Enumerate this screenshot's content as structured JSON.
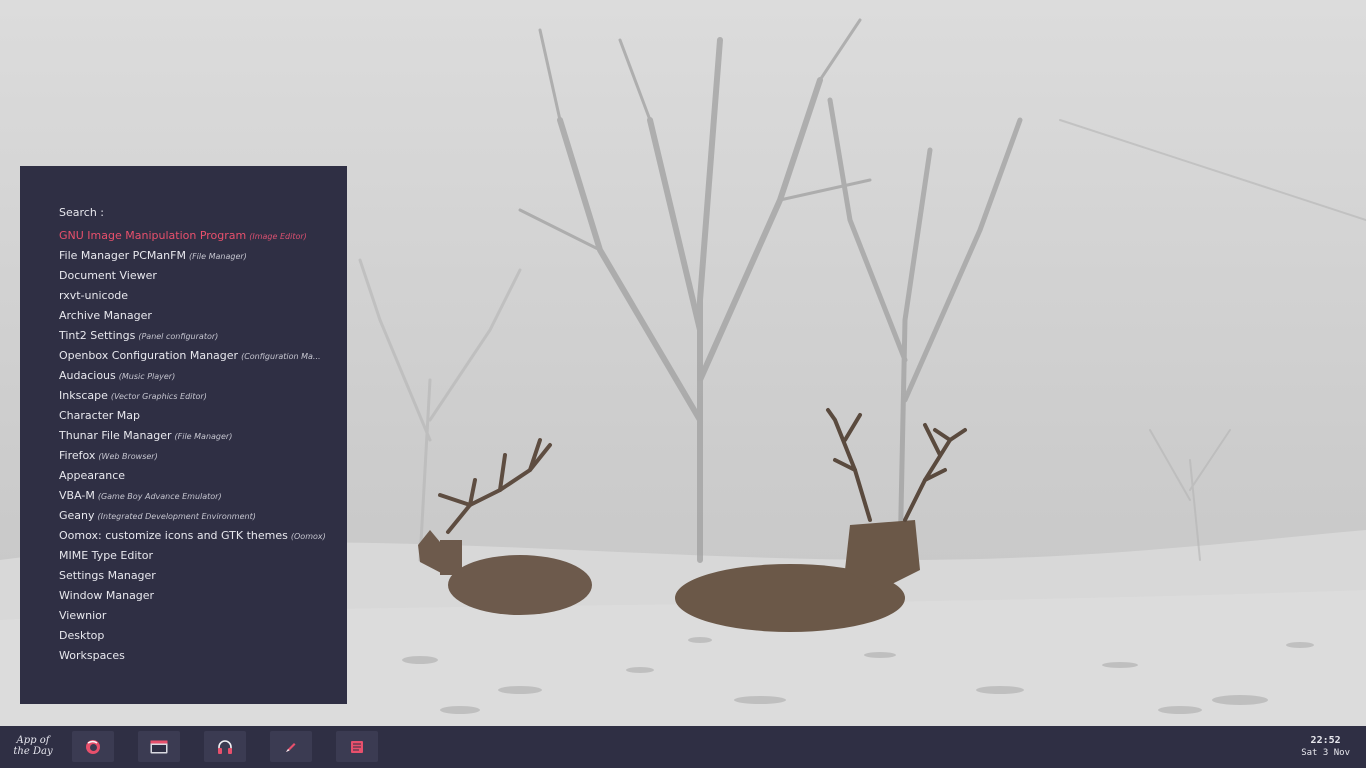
{
  "menu": {
    "search_label": "Search :",
    "search_value": "",
    "entries": [
      {
        "name": "GNU Image Manipulation Program",
        "comment": "(Image Editor)",
        "active": true
      },
      {
        "name": "File Manager PCManFM",
        "comment": "(File Manager)"
      },
      {
        "name": "Document Viewer",
        "comment": ""
      },
      {
        "name": "rxvt-unicode",
        "comment": ""
      },
      {
        "name": "Archive Manager",
        "comment": ""
      },
      {
        "name": "Tint2 Settings",
        "comment": "(Panel configurator)"
      },
      {
        "name": "Openbox Configuration Manager",
        "comment": "(Configuration Ma..."
      },
      {
        "name": "Audacious",
        "comment": "(Music Player)"
      },
      {
        "name": "Inkscape",
        "comment": "(Vector Graphics Editor)"
      },
      {
        "name": "Character Map",
        "comment": ""
      },
      {
        "name": "Thunar File Manager",
        "comment": "(File Manager)"
      },
      {
        "name": "Firefox",
        "comment": "(Web Browser)"
      },
      {
        "name": "Appearance",
        "comment": ""
      },
      {
        "name": "VBA-M",
        "comment": "(Game Boy Advance Emulator)"
      },
      {
        "name": "Geany",
        "comment": "(Integrated Development Environment)"
      },
      {
        "name": "Oomox: customize icons and GTK themes",
        "comment": "(Oomox)"
      },
      {
        "name": "MIME Type Editor",
        "comment": ""
      },
      {
        "name": "Settings Manager",
        "comment": ""
      },
      {
        "name": "Window Manager",
        "comment": ""
      },
      {
        "name": "Viewnior",
        "comment": ""
      },
      {
        "name": "Desktop",
        "comment": ""
      },
      {
        "name": "Workspaces",
        "comment": ""
      }
    ]
  },
  "taskbar": {
    "logo_line1": "App of",
    "logo_line2": "the Day",
    "launchers": [
      {
        "icon": "firefox-icon"
      },
      {
        "icon": "file-manager-icon"
      },
      {
        "icon": "headphones-icon"
      },
      {
        "icon": "pen-icon"
      },
      {
        "icon": "text-editor-icon"
      }
    ],
    "clock_time": "22:52",
    "clock_date": "Sat 3 Nov"
  },
  "colors": {
    "panel_bg": "#2f2f44",
    "launcher_bg": "#3b3b52",
    "accent": "#e8506c",
    "text": "#e8e8ee"
  }
}
